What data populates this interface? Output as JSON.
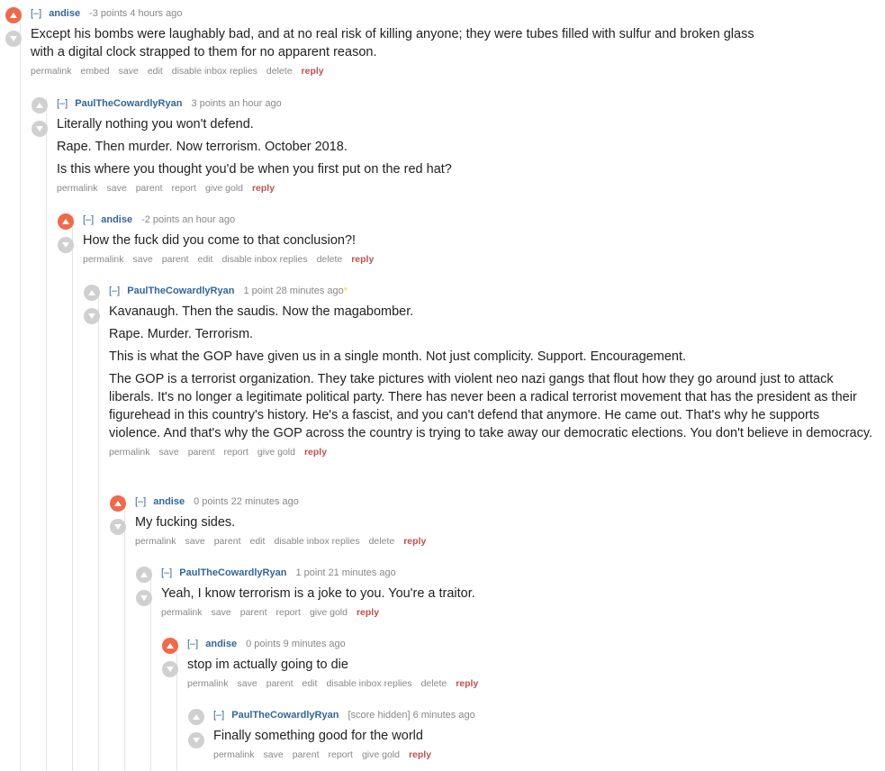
{
  "colors": {
    "upvote_active": "#ee6a4a",
    "arrow_inactive": "#d0d0d0",
    "author": "#336699",
    "reply": "#c05050"
  },
  "comments": [
    {
      "collapse": "[–]",
      "author": "andise",
      "meta": "-3 points 4 hours ago",
      "star": "",
      "upvoted": true,
      "paragraphs": [
        "Except his bombs were laughably bad, and at no real risk of killing anyone; they were tubes filled with sulfur and broken glass with a digital clock strapped to them for no apparent reason."
      ],
      "buttons": [
        "permalink",
        "embed",
        "save",
        "edit",
        "disable inbox replies",
        "delete"
      ],
      "reply": "reply"
    },
    {
      "collapse": "[–]",
      "author": "PaulTheCowardlyRyan",
      "meta": "3 points an hour ago",
      "star": "",
      "upvoted": false,
      "paragraphs": [
        "Literally nothing you won't defend.",
        "Rape. Then murder. Now terrorism. October 2018.",
        "Is this where you thought you'd be when you first put on the red hat?"
      ],
      "buttons": [
        "permalink",
        "save",
        "parent",
        "report",
        "give gold"
      ],
      "reply": "reply"
    },
    {
      "collapse": "[–]",
      "author": "andise",
      "meta": "-2 points an hour ago",
      "star": "",
      "upvoted": true,
      "paragraphs": [
        "How the fuck did you come to that conclusion?!"
      ],
      "buttons": [
        "permalink",
        "save",
        "parent",
        "edit",
        "disable inbox replies",
        "delete"
      ],
      "reply": "reply"
    },
    {
      "collapse": "[–]",
      "author": "PaulTheCowardlyRyan",
      "meta": "1 point 28 minutes ago",
      "star": "*",
      "upvoted": false,
      "paragraphs": [
        "Kavanaugh. Then the saudis. Now the magabomber.",
        "Rape. Murder. Terrorism.",
        "This is what the GOP have given us in a single month. Not just complicity. Support. Encouragement.",
        "The GOP is a terrorist organization. They take pictures with violent neo nazi gangs that flout how they go around just to attack liberals. It's no longer a legitimate political party. There has never been a radical terrorist movement that has the president as their figurehead in this country's history. He's a fascist, and you can't defend that anymore. He came out. That's why he supports violence. And that's why the GOP across the country is trying to take away our democratic elections. You don't believe in democracy."
      ],
      "buttons": [
        "permalink",
        "save",
        "parent",
        "report",
        "give gold"
      ],
      "reply": "reply"
    },
    {
      "collapse": "[–]",
      "author": "andise",
      "meta": "0 points 22 minutes ago",
      "star": "",
      "upvoted": true,
      "paragraphs": [
        "My fucking sides."
      ],
      "buttons": [
        "permalink",
        "save",
        "parent",
        "edit",
        "disable inbox replies",
        "delete"
      ],
      "reply": "reply"
    },
    {
      "collapse": "[–]",
      "author": "PaulTheCowardlyRyan",
      "meta": "1 point 21 minutes ago",
      "star": "",
      "upvoted": false,
      "paragraphs": [
        "Yeah, I know terrorism is a joke to you. You're a traitor."
      ],
      "buttons": [
        "permalink",
        "save",
        "parent",
        "report",
        "give gold"
      ],
      "reply": "reply"
    },
    {
      "collapse": "[–]",
      "author": "andise",
      "meta": "0 points 9 minutes ago",
      "star": "",
      "upvoted": true,
      "paragraphs": [
        "stop im actually going to die"
      ],
      "buttons": [
        "permalink",
        "save",
        "parent",
        "edit",
        "disable inbox replies",
        "delete"
      ],
      "reply": "reply"
    },
    {
      "collapse": "[–]",
      "author": "PaulTheCowardlyRyan",
      "meta": "[score hidden] 6 minutes ago",
      "star": "",
      "upvoted": false,
      "paragraphs": [
        "Finally something good for the world"
      ],
      "buttons": [
        "permalink",
        "save",
        "parent",
        "report",
        "give gold"
      ],
      "reply": "reply"
    }
  ]
}
